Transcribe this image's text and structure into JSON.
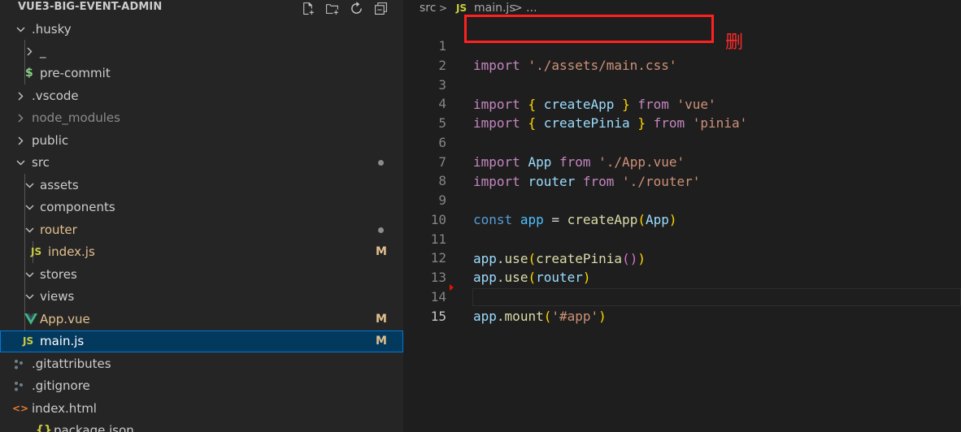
{
  "explorer": {
    "title": "VUE3-BIG-EVENT-ADMIN",
    "actions": [
      "new-file-icon",
      "new-folder-icon",
      "refresh-icon",
      "collapse-all-icon"
    ],
    "items": [
      {
        "label": ".husky",
        "kind": "folder-open"
      },
      {
        "label": "_",
        "kind": "folder-closed"
      },
      {
        "label": "pre-commit",
        "icon_glyph": "$",
        "icon": "shell-file-icon",
        "icon_color": "#89d185"
      },
      {
        "label": ".vscode",
        "kind": "folder-closed"
      },
      {
        "label": "node_modules",
        "kind": "folder-closed",
        "dimmed": true
      },
      {
        "label": "public",
        "kind": "folder-closed"
      },
      {
        "label": "src",
        "kind": "folder-open",
        "decoration": "dot"
      },
      {
        "label": "assets",
        "kind": "folder-open"
      },
      {
        "label": "components",
        "kind": "folder-open"
      },
      {
        "label": "router",
        "kind": "folder-open",
        "decoration": "dot",
        "modified": true
      },
      {
        "label": "index.js",
        "icon_glyph": "JS",
        "icon": "js-file-icon",
        "icon_color": "#cbcb41",
        "badge": "M",
        "modified": true
      },
      {
        "label": "stores",
        "kind": "folder-open"
      },
      {
        "label": "views",
        "kind": "folder-open"
      },
      {
        "label": "App.vue",
        "icon": "vue-file-icon",
        "icon_color": "#41b883",
        "badge": "M",
        "modified": true
      },
      {
        "label": "main.js",
        "icon_glyph": "JS",
        "icon": "js-file-icon",
        "icon_color": "#cbcb41",
        "badge": "M",
        "selected": true
      },
      {
        "label": ".gitattributes",
        "icon": "git-file-icon",
        "icon_color": "#6d8086"
      },
      {
        "label": ".gitignore",
        "icon": "git-file-icon",
        "icon_color": "#6d8086"
      },
      {
        "label": "index.html",
        "icon_glyph": "<>",
        "icon": "html-file-icon",
        "icon_color": "#e37933"
      },
      {
        "label": "package.json",
        "icon_glyph": "{}",
        "icon": "json-file-icon",
        "icon_color": "#cbcb41"
      }
    ]
  },
  "editor": {
    "breadcrumb": {
      "folder": "src",
      "separator": ">",
      "file_icon": "JS",
      "file": "main.js",
      "ellipsis": "> ..."
    },
    "annotation": "删",
    "lines": [
      {
        "n": "1",
        "text": "import './assets/main.css'"
      },
      {
        "n": "2",
        "text": ""
      },
      {
        "n": "3",
        "text": "import { createApp } from 'vue'"
      },
      {
        "n": "4",
        "text": "import { createPinia } from 'pinia'"
      },
      {
        "n": "5",
        "text": ""
      },
      {
        "n": "6",
        "text": "import App from './App.vue'"
      },
      {
        "n": "7",
        "text": "import router from './router'"
      },
      {
        "n": "8",
        "text": ""
      },
      {
        "n": "9",
        "text": "const app = createApp(App)"
      },
      {
        "n": "10",
        "text": ""
      },
      {
        "n": "11",
        "text": "app.use(createPinia())"
      },
      {
        "n": "12",
        "text": "app.use(router)"
      },
      {
        "n": "13",
        "text": ""
      },
      {
        "n": "14",
        "text": "app.mount('#app')"
      },
      {
        "n": "15",
        "text": ""
      }
    ],
    "colors": {
      "keyword": "#c586c0",
      "string": "#ce9178",
      "variable": "#9cdcfe",
      "function": "#dcdcaa",
      "highlight_box": "#ff2020"
    }
  }
}
